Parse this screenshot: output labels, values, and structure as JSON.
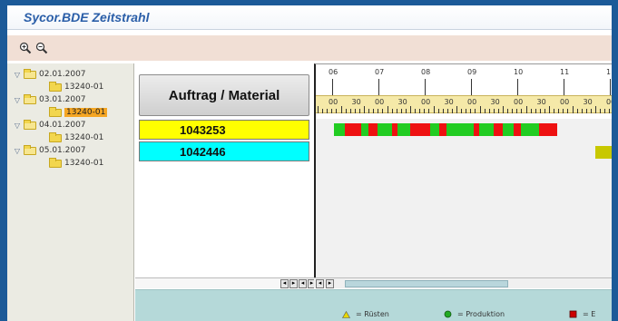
{
  "window": {
    "title": "Sycor.BDE Zeitstrahl"
  },
  "toolbar": {
    "zoom_in_icon": "zoom-in-icon",
    "zoom_out_icon": "zoom-out-icon"
  },
  "tree": {
    "nodes": [
      {
        "label": "02.01.2007",
        "level": 0,
        "toggle": "▽",
        "open": true
      },
      {
        "label": "13240-01",
        "level": 1
      },
      {
        "label": "03.01.2007",
        "level": 0,
        "toggle": "▽",
        "open": true
      },
      {
        "label": "13240-01",
        "level": 1,
        "selected": true
      },
      {
        "label": "04.01.2007",
        "level": 0,
        "toggle": "▽",
        "open": true
      },
      {
        "label": "13240-01",
        "level": 1
      },
      {
        "label": "05.01.2007",
        "level": 0,
        "toggle": "▽",
        "open": true
      },
      {
        "label": "13240-01",
        "level": 1
      }
    ]
  },
  "orders": {
    "header": "Auftrag / Material",
    "rows": [
      {
        "number": "1043253",
        "color": "#ffff00"
      },
      {
        "number": "1042446",
        "color": "#00ffff"
      }
    ]
  },
  "timeline": {
    "hours": [
      "06",
      "07",
      "08",
      "09",
      "10",
      "11",
      "1"
    ],
    "minutes": [
      "00",
      "30",
      "00",
      "30",
      "00",
      "30",
      "00",
      "30",
      "00",
      "30",
      "00",
      "30",
      "00",
      "30"
    ],
    "row1_segments": [
      {
        "color": "#22cc22"
      },
      {
        "color": "#ee1111"
      },
      {
        "color": "#22cc22"
      },
      {
        "color": "#ee1111"
      },
      {
        "color": "#22cc22"
      },
      {
        "color": "#ee1111"
      },
      {
        "color": "#22cc22"
      },
      {
        "color": "#ee1111"
      },
      {
        "color": "#22cc22"
      },
      {
        "color": "#ee1111"
      },
      {
        "color": "#22cc22"
      },
      {
        "color": "#ee1111"
      },
      {
        "color": "#22cc22"
      },
      {
        "color": "#ee1111"
      },
      {
        "color": "#22cc22"
      },
      {
        "color": "#ee1111"
      },
      {
        "color": "#22cc22"
      },
      {
        "color": "#ee1111"
      }
    ],
    "row2_segments": [
      {
        "color": "#c8c800"
      }
    ]
  },
  "legend": [
    {
      "symbol": "triangle",
      "color": "#e8d800",
      "label": "= Rüsten"
    },
    {
      "symbol": "circle",
      "color": "#22aa22",
      "label": "= Produktion"
    },
    {
      "symbol": "square",
      "color": "#cc0000",
      "label": "= E"
    }
  ],
  "colors": {
    "background": "#1c5a98",
    "toolbar": "#f1dfd5",
    "tree_bg": "#ebebe3",
    "status": "#b5d9d9"
  }
}
